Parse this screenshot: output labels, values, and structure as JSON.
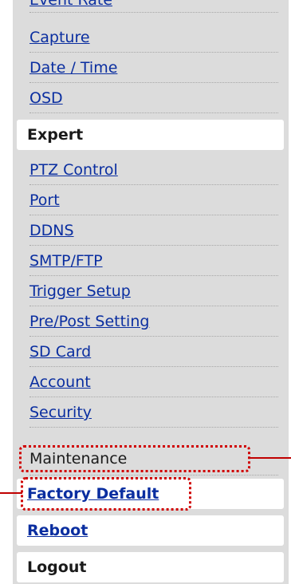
{
  "menu": {
    "top_items": [
      "Event Rate",
      "Capture",
      "Date / Time",
      "OSD"
    ],
    "expert_header": "Expert",
    "expert_items": [
      "PTZ Control",
      "Port",
      "DDNS",
      "SMTP/FTP",
      "Trigger Setup",
      "Pre/Post Setting",
      "SD Card",
      "Account",
      "Security"
    ],
    "maintenance": "Maintenance",
    "factory_default": "Factory Default",
    "reboot": "Reboot",
    "logout": "Logout"
  },
  "colors": {
    "link": "#0a2ea0",
    "highlight": "#d00000",
    "panel": "#dcdcdc"
  }
}
